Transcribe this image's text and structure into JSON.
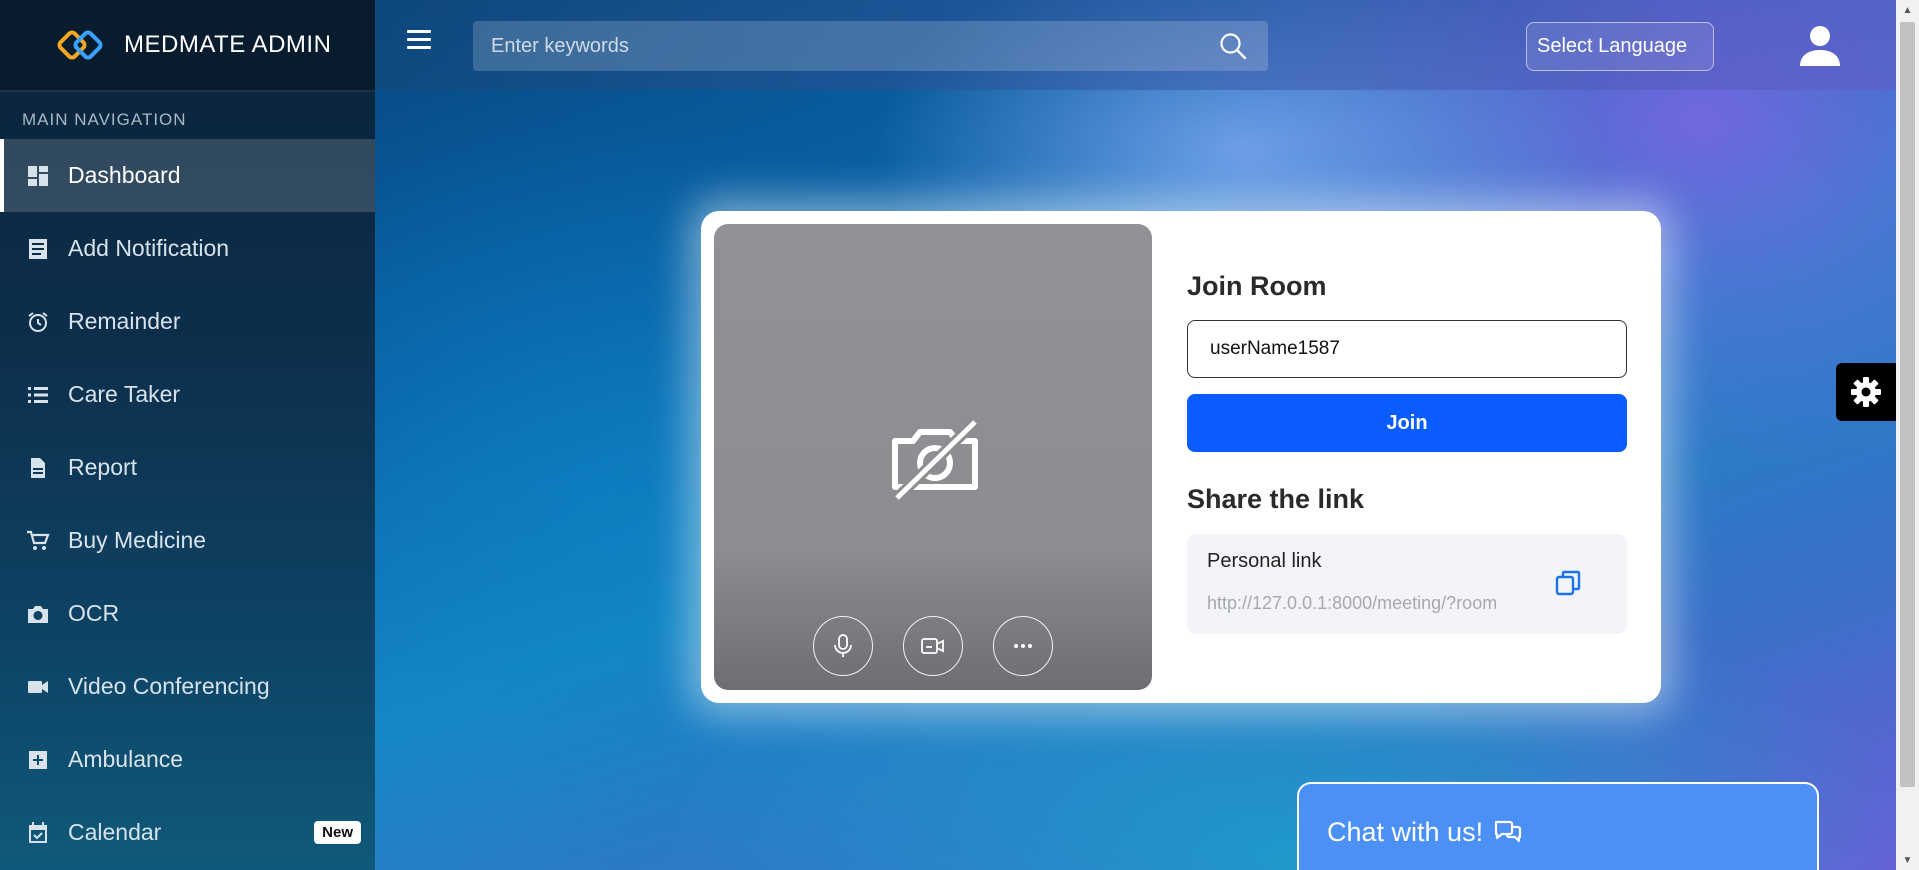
{
  "brand": {
    "title": "MEDMATE ADMIN"
  },
  "sidebar": {
    "header": "MAIN NAVIGATION",
    "items": [
      {
        "label": "Dashboard",
        "icon": "dashboard-icon",
        "active": true
      },
      {
        "label": "Add Notification",
        "icon": "notification-list-icon"
      },
      {
        "label": "Remainder",
        "icon": "alarm-clock-icon"
      },
      {
        "label": "Care Taker",
        "icon": "list-icon"
      },
      {
        "label": "Report",
        "icon": "report-document-icon"
      },
      {
        "label": "Buy Medicine",
        "icon": "shopping-cart-icon"
      },
      {
        "label": "OCR",
        "icon": "camera-icon"
      },
      {
        "label": "Video Conferencing",
        "icon": "video-camera-icon"
      },
      {
        "label": "Ambulance",
        "icon": "plus-square-icon"
      },
      {
        "label": "Calendar",
        "icon": "calendar-check-icon",
        "badge": "New"
      }
    ]
  },
  "topbar": {
    "search_placeholder": "Enter keywords",
    "language_label": "Select Language"
  },
  "meeting": {
    "join_title": "Join Room",
    "room_input_value": "userName1587",
    "join_button": "Join",
    "share_title": "Share the link",
    "personal_link_label": "Personal link",
    "personal_link_url": "http://127.0.0.1:8000/meeting/?room"
  },
  "chat": {
    "label": "Chat with us!"
  },
  "colors": {
    "join_button": "#0a5cff",
    "chat_widget": "#4b90f5",
    "sidebar_bg": "#0d2f4c",
    "copy_icon": "#1a73e8"
  }
}
